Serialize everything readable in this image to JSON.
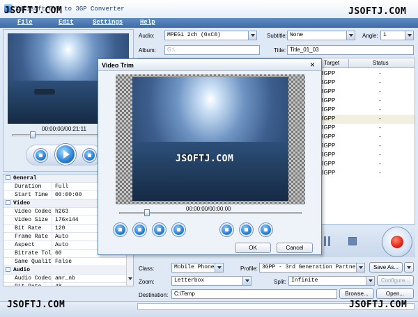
{
  "window": {
    "title": "Xilisoft DVD to 3GP Converter",
    "watermark": "JSOFTJ.COM"
  },
  "menu": [
    "File",
    "Edit",
    "Settings",
    "Help"
  ],
  "top_fields": {
    "audio_label": "Audio:",
    "audio_value": "MPEG1 2ch (0xC0)",
    "subtitle_label": "Subtitle:",
    "subtitle_value": "None",
    "angle_label": "Angle:",
    "angle_value": "1",
    "album_label": "Album:",
    "album_value": "G:\\",
    "title_label": "Title:",
    "title_value": "Title_01_03"
  },
  "file_list": {
    "headers": [
      "Target",
      "Status"
    ],
    "rows": [
      {
        "target": "3GPP",
        "status": "-"
      },
      {
        "target": "3GPP",
        "status": "-"
      },
      {
        "target": "3GPP",
        "status": "-"
      },
      {
        "target": "3GPP",
        "status": "-"
      },
      {
        "target": "3GPP",
        "status": "-"
      },
      {
        "target": "3GPP",
        "status": "-"
      },
      {
        "target": "3GPP",
        "status": "-"
      },
      {
        "target": "3GPP",
        "status": "-"
      },
      {
        "target": "3GPP",
        "status": "-"
      },
      {
        "target": "3GPP",
        "status": "-"
      },
      {
        "target": "3GPP",
        "status": "-"
      },
      {
        "target": "3GPP",
        "status": "-"
      }
    ]
  },
  "preview": {
    "time": "00:00:00/00:21:11",
    "seek_fraction": 0.1
  },
  "properties": [
    {
      "type": "category",
      "name": "General"
    },
    {
      "type": "row",
      "name": "Duration",
      "value": "Full"
    },
    {
      "type": "row",
      "name": "Start Time",
      "value": "00:00:00"
    },
    {
      "type": "category",
      "name": "Video"
    },
    {
      "type": "row",
      "name": "Video Codec",
      "value": "h263"
    },
    {
      "type": "row",
      "name": "Video Size",
      "value": "176x144"
    },
    {
      "type": "row",
      "name": "Bit Rate",
      "value": "120"
    },
    {
      "type": "row",
      "name": "Frame Rate",
      "value": "Auto"
    },
    {
      "type": "row",
      "name": "Aspect",
      "value": "Auto"
    },
    {
      "type": "row",
      "name": "Bitrate Tol...",
      "value": "60"
    },
    {
      "type": "row",
      "name": "Same Quality",
      "value": "False"
    },
    {
      "type": "category",
      "name": "Audio"
    },
    {
      "type": "row",
      "name": "Audio Codec",
      "value": "amr_nb"
    },
    {
      "type": "row",
      "name": "Bit Rate",
      "value": "48"
    }
  ],
  "bottom": {
    "class_label": "Class:",
    "class_value": "Mobile Phone",
    "profile_label": "Profile:",
    "profile_value": "3GPP - 3rd Generation Partnership",
    "save_as": "Save As...",
    "zoom_label": "Zoom:",
    "zoom_value": "Letterbox",
    "split_label": "Split:",
    "split_value": "Infinite",
    "configure": "Configure...",
    "destination_label": "Destination:",
    "destination_value": "C:\\Temp",
    "browse": "Browse...",
    "open": "Open..."
  },
  "dialog": {
    "title": "Video Trim",
    "time": "00:00:00/00:00:00",
    "ok": "OK",
    "cancel": "Cancel",
    "close_glyph": "×",
    "watermark": "JSOFTJ.COM"
  },
  "colors": {
    "accent": "#3f6ba6",
    "convert_button": "#e2231a"
  }
}
